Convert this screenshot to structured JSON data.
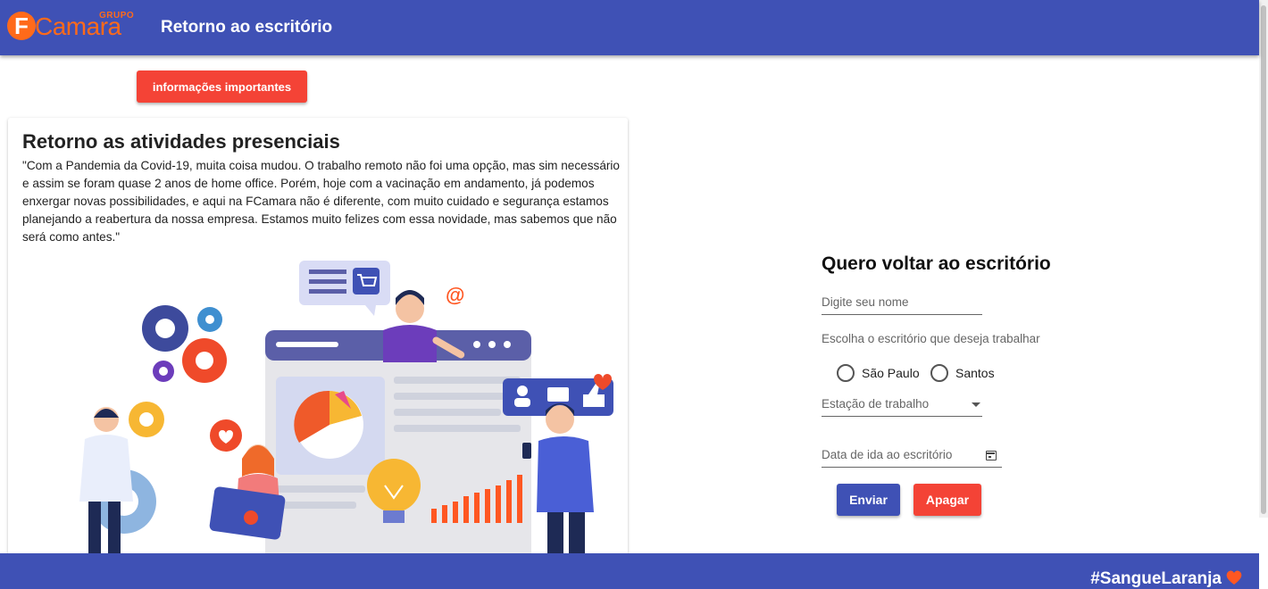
{
  "header": {
    "logo_word": "Camara",
    "logo_letter": "F",
    "logo_group": "GRUPO",
    "title": "Retorno ao escritório"
  },
  "info_button": "informações importantes",
  "left_card": {
    "heading": "Retorno as atividades presenciais",
    "paragraph": "\"Com a Pandemia da Covid-19, muita coisa mudou. O trabalho remoto não foi uma opção, mas sim necessário e assim se foram quase 2 anos de home office. Porém, hoje com a vacinação em andamento, já podemos enxergar novas possibilidades, e aqui na FCamara não é diferente, com muito cuidado e segurança estamos planejando a reabertura da nossa empresa. Estamos muito felizes com essa novidade, mas sabemos que não será como antes.\""
  },
  "form": {
    "title": "Quero voltar ao escritório",
    "name_placeholder": "Digite seu nome",
    "office_label": "Escolha o escritório que deseja trabalhar",
    "office_options": [
      "São Paulo",
      "Santos"
    ],
    "workstation_label": "Estação de trabalho",
    "date_label": "Data de ida ao escritório",
    "submit": "Enviar",
    "clear": "Apagar"
  },
  "footer": {
    "tag": "#SangueLaranja"
  },
  "colors": {
    "primary": "#3f51b5",
    "accent_red": "#f44336",
    "brand_orange": "#ff6a1a"
  },
  "icons": [
    "calendar-icon",
    "dropdown-arrow-icon",
    "heart-icon",
    "cart-icon",
    "gear-icon",
    "pie-chart-icon",
    "bar-chart-icon",
    "lightbulb-icon",
    "like-icon",
    "chat-icon",
    "at-icon"
  ]
}
